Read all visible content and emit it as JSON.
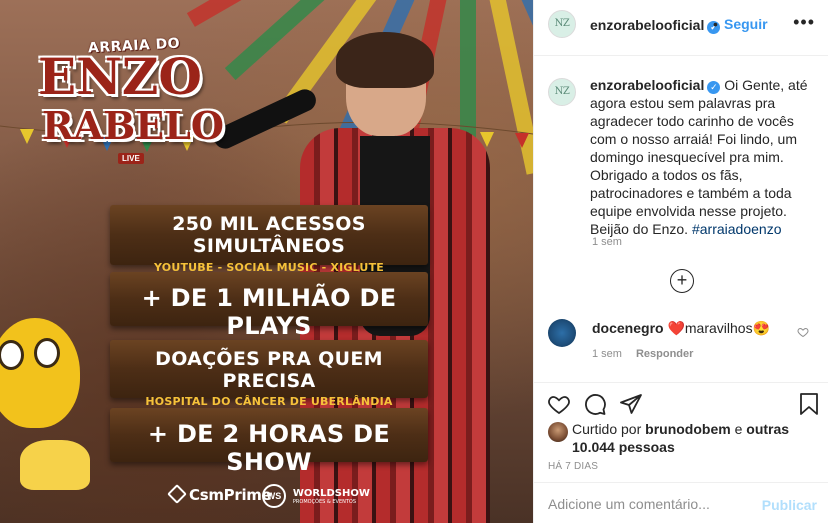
{
  "post": {
    "logo_arraia": "ARRAIA DO",
    "logo_enzo": "ENZO",
    "logo_rabelo": "RABELO",
    "logo_live": "LIVE",
    "plank1_big": "250 MIL ACESSOS SIMULTÂNEOS",
    "plank1_small": "YOUTUBE - SOCIAL MUSIC - XIGLUTE",
    "plank2_big": "+ DE 1 MILHÃO DE PLAYS",
    "plank3_big": "DOAÇÕES PRA QUEM PRECISA",
    "plank3_small": "HOSPITAL DO CÂNCER DE UBERLÂNDIA",
    "plank4_big": "+ DE 2 HORAS DE SHOW",
    "sponsor1": "CsmPrime",
    "sponsor2_title": "WORLDSHOW",
    "sponsor2_sub": "PROMOÇÕES & EVENTOS",
    "sponsor2_disc": "WS"
  },
  "header": {
    "avatar_initials": "NZ",
    "username": "enzorabelooficial",
    "separator": "•",
    "follow_label": "Seguir",
    "more_label": "•••"
  },
  "caption": {
    "avatar_initials": "NZ",
    "username": "enzorabelooficial",
    "text": " Oi Gente, até agora estou sem palavras pra agradecer todo carinho de vocês com o nosso arraiá! Foi lindo, um domingo inesquecível pra mim. Obrigado a todos os fãs, patrocinadores e também a toda equipe envolvida nesse projeto. Beijão do Enzo. ",
    "hashtag": "#arraiadoenzo",
    "time": "1 sem"
  },
  "load_more": "+",
  "comment": {
    "username": "docenegro",
    "text": " ❤️maravilhos😍",
    "time": "1 sem",
    "reply_label": "Responder"
  },
  "likes": {
    "prefix": "Curtido por ",
    "first_user": "brunodobem",
    "middle": " e ",
    "others": "outras 10.044 pessoas"
  },
  "post_age": "HÁ 7 DIAS",
  "add_comment": {
    "placeholder": "Adicione um comentário...",
    "publish_label": "Publicar"
  },
  "colors": {
    "link_blue": "#3897f0",
    "hashtag_blue": "#00376b",
    "muted_gray": "#8e8e8e",
    "publish_disabled": "#b2dffc",
    "border": "#efefef",
    "heart_red": "#ed4956"
  },
  "icons": [
    "verified-badge-icon",
    "more-options-icon",
    "add-circle-icon",
    "heart-outline-icon",
    "comment-icon",
    "share-icon",
    "bookmark-icon"
  ]
}
